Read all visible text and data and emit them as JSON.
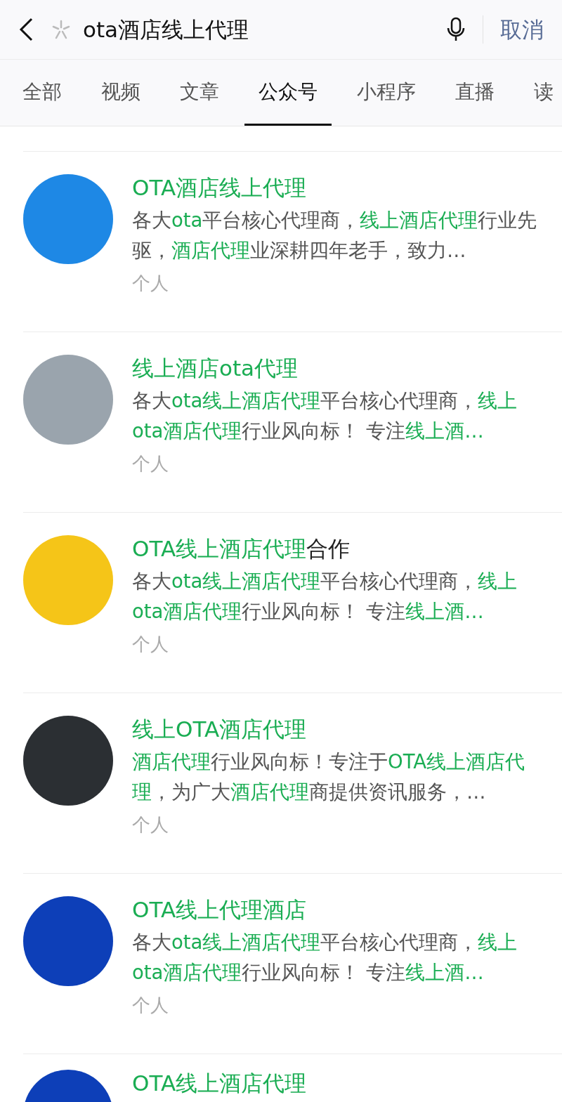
{
  "search": {
    "query": "ota酒店线上代理",
    "cancel": "取消"
  },
  "tabs": [
    {
      "label": "全部",
      "selected": false
    },
    {
      "label": "视频",
      "selected": false
    },
    {
      "label": "文章",
      "selected": false
    },
    {
      "label": "公众号",
      "selected": true
    },
    {
      "label": "小程序",
      "selected": false
    },
    {
      "label": "直播",
      "selected": false
    },
    {
      "label": "读",
      "selected": false
    }
  ],
  "results": [
    {
      "color": "#1e88e5",
      "title": [
        {
          "text": "OTA酒店线上代理",
          "highlight": true
        }
      ],
      "description": [
        {
          "text": "各大",
          "highlight": false
        },
        {
          "text": "ota",
          "highlight": true
        },
        {
          "text": "平台核心代理商，",
          "highlight": false
        },
        {
          "text": "线上酒店代理",
          "highlight": true
        },
        {
          "text": "行业先驱，",
          "highlight": false
        },
        {
          "text": "酒店代理",
          "highlight": true
        },
        {
          "text": "业深耕四年老手，致力…",
          "highlight": false
        }
      ],
      "type": "个人"
    },
    {
      "color": "#9aa4ad",
      "title": [
        {
          "text": "线上酒店ota代理",
          "highlight": true
        }
      ],
      "description": [
        {
          "text": "各大",
          "highlight": false
        },
        {
          "text": "ota线上酒店代理",
          "highlight": true
        },
        {
          "text": "平台核心代理商，",
          "highlight": false
        },
        {
          "text": "线上ota酒店代理",
          "highlight": true
        },
        {
          "text": "行业风向标！ 专注",
          "highlight": false
        },
        {
          "text": "线上酒…",
          "highlight": true
        }
      ],
      "type": "个人"
    },
    {
      "color": "#f5c518",
      "title": [
        {
          "text": "OTA线上酒店代理",
          "highlight": true
        },
        {
          "text": "合作",
          "highlight": false
        }
      ],
      "description": [
        {
          "text": "各大",
          "highlight": false
        },
        {
          "text": "ota线上酒店代理",
          "highlight": true
        },
        {
          "text": "平台核心代理商，",
          "highlight": false
        },
        {
          "text": "线上ota酒店代理",
          "highlight": true
        },
        {
          "text": "行业风向标！ 专注",
          "highlight": false
        },
        {
          "text": "线上酒…",
          "highlight": true
        }
      ],
      "type": "个人"
    },
    {
      "color": "#2b2f33",
      "title": [
        {
          "text": "线上OTA酒店代理",
          "highlight": true
        }
      ],
      "description": [
        {
          "text": "酒店代理",
          "highlight": true
        },
        {
          "text": "行业风向标！专注于",
          "highlight": false
        },
        {
          "text": "OTA线上酒店代理",
          "highlight": true
        },
        {
          "text": "，为广大",
          "highlight": false
        },
        {
          "text": "酒店代理",
          "highlight": true
        },
        {
          "text": "商提供资讯服务，…",
          "highlight": false
        }
      ],
      "type": "个人"
    },
    {
      "color": "#0d3fb8",
      "title": [
        {
          "text": "OTA线上代理酒店",
          "highlight": true
        }
      ],
      "description": [
        {
          "text": "各大",
          "highlight": false
        },
        {
          "text": "ota线上酒店代理",
          "highlight": true
        },
        {
          "text": "平台核心代理商，",
          "highlight": false
        },
        {
          "text": "线上ota酒店代理",
          "highlight": true
        },
        {
          "text": "行业风向标！ 专注",
          "highlight": false
        },
        {
          "text": "线上酒…",
          "highlight": true
        }
      ],
      "type": "个人"
    },
    {
      "color": "#0d3fb8",
      "title": [
        {
          "text": "OTA线上酒店代理",
          "highlight": true
        }
      ]
    }
  ]
}
